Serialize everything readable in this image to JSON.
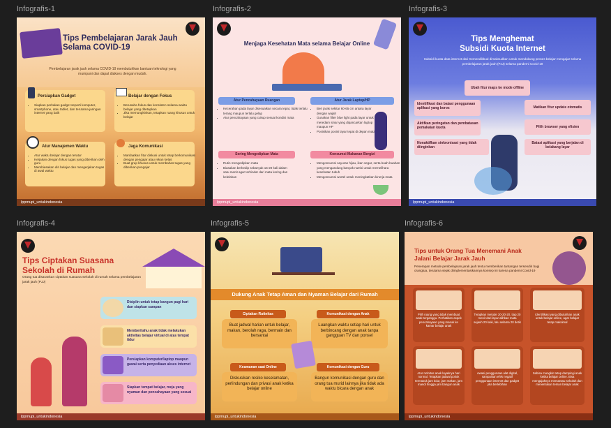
{
  "canvas": {
    "background": "#1e1e1e"
  },
  "frames": [
    {
      "label": "Infografis-1",
      "title_line1": "Tips Pembelajaran Jarak Jauh",
      "title_line2": "Selama COVID-19",
      "intro": "Pembelajaran jarak jauh selama COVID-19 membutuhkan bantuan teknologi yang mumpuni dan dapat diakses dengan mudah.",
      "cards": [
        {
          "title": "Persiapkan Gadget",
          "items": [
            "Siapkan perkakas gadget seperti komputer, smartphone, atau tablet, dan terutama jaringan internet yang baik"
          ]
        },
        {
          "title": "Belajar dengan Fokus",
          "items": [
            "Berusaha fokus dan konsisten selama waktu belajar yang ditetapkan",
            "Jika memungkinkan, tetapkan ruang khusus untuk belajar"
          ]
        },
        {
          "title": "Atur Manajemen Waktu",
          "items": [
            "Atur waktu belajar dengan teratur",
            "Kerjakan dengan fokus tugas yang diberikan oleh guru",
            "Membiasakan diri belajar dan mengerjakan tugas di awal waktu"
          ]
        },
        {
          "title": "Jaga Komunikasi",
          "items": [
            "Manfaatkan fitur diskusi untuk tetap berkomunikasi dengan pengajar atau rekan kelas",
            "Buat grup khusus untuk membahas tugas yang diberikan pengajar"
          ]
        }
      ],
      "footer": "lppmupi_untukindonesia"
    },
    {
      "label": "Infografis-2",
      "title": "Menjaga Kesehatan Mata selama Belajar Online",
      "sections": [
        {
          "title": "Atur Pencahayaan Ruangan",
          "items": [
            "Kecerahan pada layar disesuaikan secara tepat, tidak terlalu terang maupun terlalu gelap",
            "Atur pencahayaan yang cukup sesuai kondisi mata"
          ]
        },
        {
          "title": "Atur Jarak Laptop/HP",
          "items": [
            "Beri jarak sekitar 60-65 cm antara layar dengan wajah",
            "Gunakan filter blue light pada layar untuk meredam sinar yang dipancarkan laptop maupun HP",
            "Posisikan posisi layar tepat di depan mata"
          ]
        },
        {
          "title": "Sering Mengedipkan Mata",
          "items": [
            "Rutin mengedipkan mata",
            "Biasakan berkedip sebanyak 15-20 kali dalam satu menit agar terhindar dari mata kering dan kelelahan"
          ]
        },
        {
          "title": "Konsumsi Makanan Bergizi",
          "items": [
            "Mengonsumsi sayuran hijau, ikan segar, serta buah-buahan yang mengandung banyak nutrisi untuk memelihara kesehatan tubuh",
            "Mengonsumsi wortel untuk meningkatkan kinerja mata"
          ]
        }
      ],
      "footer": "lppmupi_untukindonesia"
    },
    {
      "label": "Infografis-3",
      "title_line1": "Tips Menghemat",
      "title_line2": "Subsidi Kuota Internet",
      "intro": "Subsidi kuota data internet dari Kemendikbud dimaksudkan untuk mendukung proses belajar mengajar selama pembelajaran jarak jauh (PJJ) selama pandemi Covid-19",
      "tips": [
        "Ubah fitur maps ke mode offline",
        "Identifikasi dan batasi penggunaan aplikasi yang boros",
        "Matikan fitur update otomatis",
        "Aktifkan peringatan dan pembatasan pemakaian kuota",
        "Pilih browser yang efisien",
        "Nonaktifkan sinkronisasi yang tidak diinginkan",
        "Batasi aplikasi yang berjalan di belakang layar"
      ],
      "footer": "lppmupi_untukindonesia"
    },
    {
      "label": "Infografis-4",
      "title_line1": "Tips Ciptakan Suasana",
      "title_line2": "Sekolah di Rumah",
      "intro": "Orang tua disarankan ciptakan suasana sekolah di rumah selama pembelajaran jarak jauh (PJJ)",
      "tips": [
        "Disiplin untuk tetap bangun pagi hari dan siapkan sarapan",
        "Memberitahu anak tidak melakukan aktivitas belajar virtual di atas tempat tidur",
        "Persiapkan komputer/laptop maupun gawai serta penyediaan akses internet",
        "Siapkan tempat belajar, meja yang nyaman dan pencahayaan yang sesuai"
      ],
      "footer": "lppmupi_untukindonesia"
    },
    {
      "label": "Infografis-5",
      "title": "Dukung Anak Tetap Aman dan Nyaman Belajar dari Rumah",
      "boxes": [
        {
          "title": "Ciptakan Rutinitas",
          "text": "Buat jadwal harian untuk belajar, makan, berolah raga, bermain dan bersantai"
        },
        {
          "title": "Komunikasi dengan Anak",
          "text": "Luangkan waktu setiap hari untuk berbincang dengan anak tanpa gangguan TV dan ponsel"
        },
        {
          "title": "Keamanan saat Online",
          "text": "Diskusikan resiko keselamatan, perlindungan dan privasi anak ketika belajar online"
        },
        {
          "title": "Komunikasi dengan Guru",
          "text": "Bangun komunikasi dengan guru dan orang tua murid lainnya jika tidak ada waktu bicara dengan anak"
        }
      ],
      "footer": "lppmupi_untukindonesia"
    },
    {
      "label": "Infografis-6",
      "title_line1": "Tips untuk Orang Tua Menemani Anak",
      "title_line2": "Jalani Belajar Jarak Jauh",
      "intro": "Penerapan metode pembelajaran jarak jauh tentu memberikan tantangan tersendiri bagi orangtua, terutama sejak diimplementasikannya konsep ini karena pandemi Covid-19",
      "tips": [
        "Pilih ruang yang tidak membuat anak terganggu. Perhatikan aspek pencahayaan yang masuk ke kamar belajar anak",
        "Terapkan metode 20-20-20, tiap 20 menit dari layar alihkan mata sejauh 20 kaki, lalu selama 20 detik",
        "Identifikasi yang dibutuhkan anak untuk belajar online, agar belajar tetap maksimal",
        "Atur rutinitas anak layaknya hari normal. Tetapkan jadwal pokok termasuk jam tidur, jam makan, jam mandi hingga jam bangun anak",
        "Awasi penggunaan alat digital, sampaikan efek negatif penggunaan internet dan gadget jika berlebihan",
        "Sebisa mungkin tetap dampingi anak ketika belajar online. Bisa mengajaknya memantau sekolah dan menentukan teman belajar anak"
      ],
      "footer": "lppmupi_untukindonesia"
    }
  ]
}
